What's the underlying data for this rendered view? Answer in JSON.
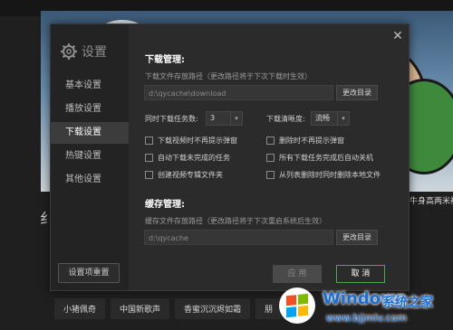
{
  "background": {
    "right_caption": "牛身高两米被",
    "left_char": "纟",
    "tags": [
      "小猪佩奇",
      "中国新歌声",
      "香蜜沉沉烬如霜",
      "朋"
    ]
  },
  "watermark": {
    "brand": "Windows",
    "suffix": "系统之家",
    "url": "www.bjjmlv.com"
  },
  "dialog": {
    "title": "设置",
    "close_glyph": "✕",
    "nav": [
      {
        "label": "基本设置",
        "active": false
      },
      {
        "label": "播放设置",
        "active": false
      },
      {
        "label": "下载设置",
        "active": true
      },
      {
        "label": "热键设置",
        "active": false
      },
      {
        "label": "其他设置",
        "active": false
      }
    ],
    "reset_label": "设置项重置",
    "download": {
      "section_title": "下载管理:",
      "path_hint": "下载文件存放路径（更改路径将于下次下载时生效）",
      "path_value": "d:\\qycache\\download",
      "change_dir_label": "更改目录",
      "tasks_label": "同时下载任务数:",
      "tasks_value": "3",
      "quality_label": "下载清晰度:",
      "quality_value": "流畅",
      "options_left": [
        "下载视频时不再提示弹窗",
        "自动下载未完成的任务",
        "创建视频专辑文件夹"
      ],
      "options_right": [
        "删除时不再提示弹窗",
        "所有下载任务完成后自动关机",
        "从列表删除时同时删除本地文件"
      ]
    },
    "cache": {
      "section_title": "缓存管理:",
      "path_hint": "缓存文件存放路径（更改路径将于下次重启系统后生效）",
      "path_value": "d:\\qycache",
      "change_dir_label": "更改目录"
    },
    "apply_label": "应 用",
    "cancel_label": "取 消"
  }
}
